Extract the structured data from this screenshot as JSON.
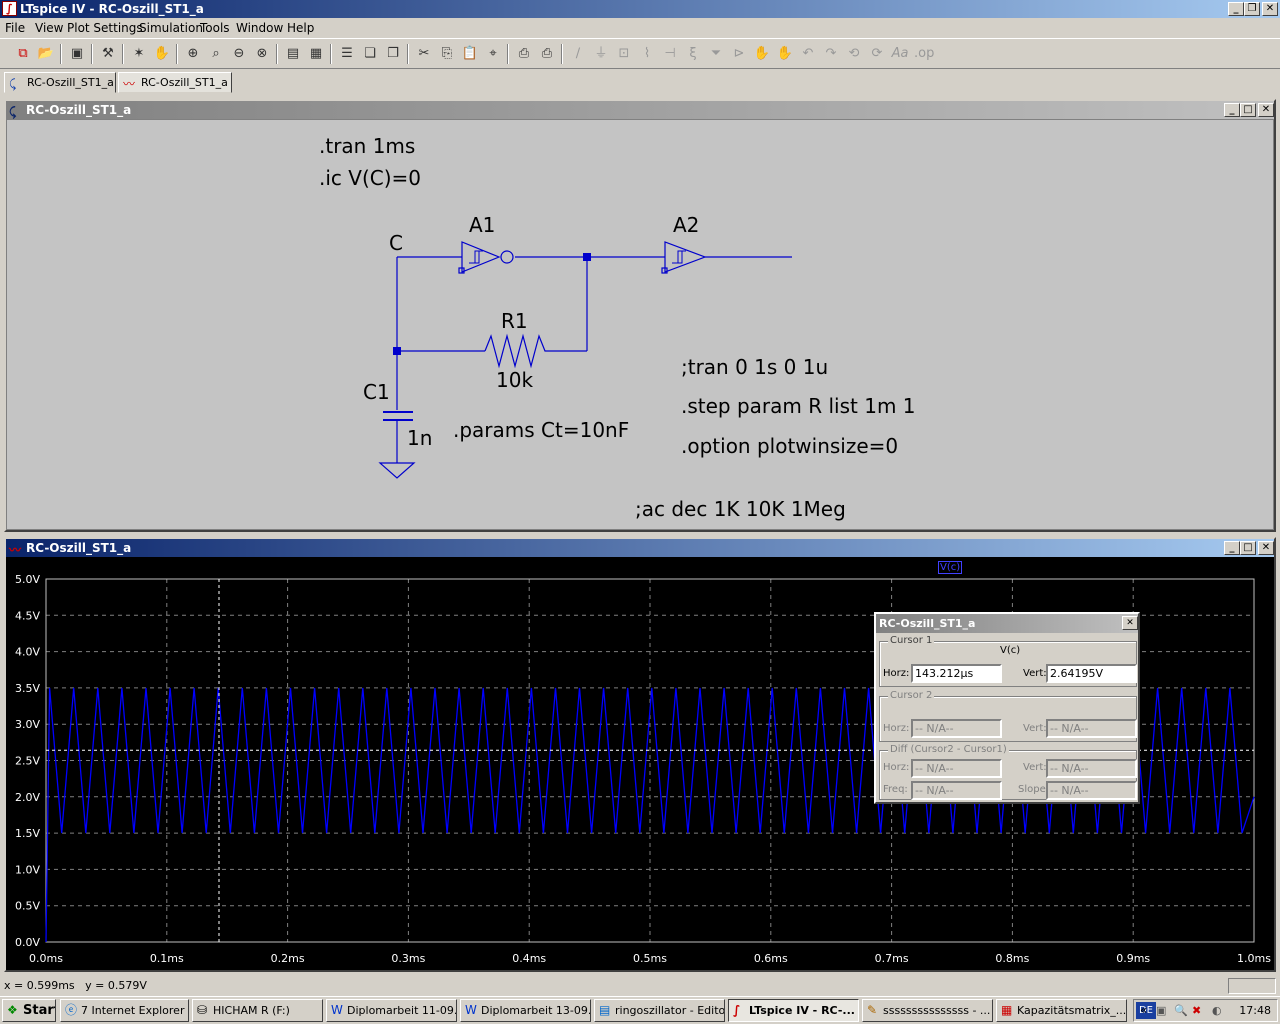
{
  "window": {
    "title": "LTspice IV - RC-Oszill_ST1_a"
  },
  "menu": [
    "File",
    "View",
    "Plot Settings",
    "Simulation",
    "Tools",
    "Window",
    "Help"
  ],
  "tabs": [
    {
      "label": "RC-Oszill_ST1_a",
      "icon": "schematic-icon"
    },
    {
      "label": "RC-Oszill_ST1_a",
      "icon": "waveform-icon"
    }
  ],
  "schematic": {
    "title": "RC-Oszill_ST1_a",
    "directives": {
      "tran": ".tran 1ms",
      "ic": ".ic V(C)=0",
      "tran2": ";tran 0 1s 0 1u",
      "step": ".step param R list  1m 1",
      "option": ".option plotwinsize=0",
      "params": ".params Ct=10nF",
      "ac": ";ac dec 1K 10K 1Meg"
    },
    "labels": {
      "node_c": "C",
      "a1": "A1",
      "a2": "A2",
      "r1": "R1",
      "r1_value": "10k",
      "c1": "C1",
      "c1_value": "1n"
    }
  },
  "plot": {
    "title": "RC-Oszill_ST1_a",
    "trace_label": "V(c)"
  },
  "chart_data": {
    "type": "line",
    "title": "",
    "xlabel": "",
    "ylabel": "",
    "x_ticks": [
      "0.0ms",
      "0.1ms",
      "0.2ms",
      "0.3ms",
      "0.4ms",
      "0.5ms",
      "0.6ms",
      "0.7ms",
      "0.8ms",
      "0.9ms",
      "1.0ms"
    ],
    "y_ticks": [
      "5.0V",
      "4.5V",
      "4.0V",
      "3.5V",
      "3.0V",
      "2.5V",
      "2.0V",
      "1.5V",
      "1.0V",
      "0.5V",
      "0.0V"
    ],
    "xlim": [
      0,
      1.0
    ],
    "ylim": [
      0,
      5.0
    ],
    "x_unit": "ms",
    "y_unit": "V",
    "series": [
      {
        "name": "V(c)",
        "color": "#0000ff",
        "waveform": "triangle",
        "initial_rise_from": 0.0,
        "min": 1.5,
        "max": 3.5,
        "cycles": 50
      }
    ],
    "cursor_x": 0.143212,
    "cursor_y": 2.64195,
    "grid": true
  },
  "cursor_dialog": {
    "title": "RC-Oszill_ST1_a",
    "cursor1_label": "Cursor 1",
    "trace": "V(c)",
    "horz_label": "Horz:",
    "vert_label": "Vert:",
    "horz_value": "143.212µs",
    "vert_value": "2.64195V",
    "cursor2_label": "Cursor 2",
    "c2_horz": "-- N/A--",
    "c2_vert": "-- N/A--",
    "diff_label": "Diff (Cursor2 - Cursor1)",
    "diff_horz": "-- N/A--",
    "diff_vert": "-- N/A--",
    "freq_label": "Freq:",
    "freq": "-- N/A--",
    "slope_label": "Slope:",
    "slope": "-- N/A--"
  },
  "status": {
    "text": "x = 0.599ms   y = 0.579V"
  },
  "taskbar": {
    "start": "Start",
    "items": [
      {
        "label": "7 Internet Explorer",
        "icon": "ie-icon"
      },
      {
        "label": "HICHAM R (F:)",
        "icon": "drive-icon"
      },
      {
        "label": "Diplomarbeit 11-09....",
        "icon": "word-icon"
      },
      {
        "label": "Diplomarbeit 13-09....",
        "icon": "word-icon"
      },
      {
        "label": "ringoszillator - Editor",
        "icon": "notepad-icon"
      },
      {
        "label": "LTspice IV - RC-...",
        "icon": "ltspice-icon"
      },
      {
        "label": "sssssssssssssss - ...",
        "icon": "paint-icon"
      },
      {
        "label": "Kapazitätsmatrix_...",
        "icon": "pdf-icon"
      }
    ],
    "lang": "DE",
    "clock": "17:48"
  }
}
